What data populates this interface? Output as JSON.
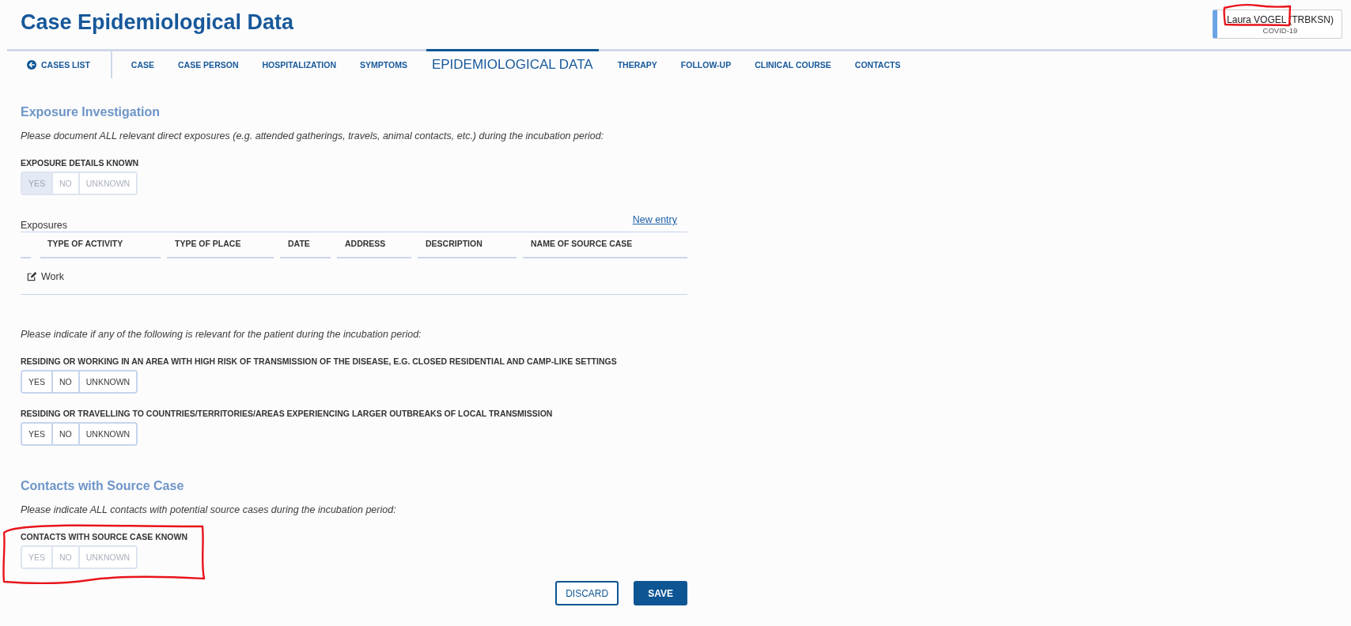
{
  "page": {
    "title": "Case Epidemiological Data"
  },
  "user": {
    "name": "Laura VOGEL (TRBKSN)",
    "disease": "COVID-19",
    "circled": true
  },
  "tabs": [
    {
      "label": "CASES LIST",
      "kind": "back",
      "selected": false
    },
    {
      "label": "CASE",
      "kind": "tab",
      "selected": false
    },
    {
      "label": "CASE PERSON",
      "kind": "tab",
      "selected": false
    },
    {
      "label": "HOSPITALIZATION",
      "kind": "tab",
      "selected": false
    },
    {
      "label": "SYMPTOMS",
      "kind": "tab",
      "selected": false
    },
    {
      "label": "EPIDEMIOLOGICAL DATA",
      "kind": "tab",
      "selected": true
    },
    {
      "label": "THERAPY",
      "kind": "tab",
      "selected": false
    },
    {
      "label": "FOLLOW-UP",
      "kind": "tab",
      "selected": false
    },
    {
      "label": "CLINICAL COURSE",
      "kind": "tab",
      "selected": false
    },
    {
      "label": "CONTACTS",
      "kind": "tab",
      "selected": false
    }
  ],
  "content": [
    {
      "kind": "heading",
      "text": "Exposure Investigation"
    },
    {
      "kind": "note",
      "text": "Please document ALL relevant direct exposures (e.g. attended gatherings, travels, animal contacts, etc.) during the incubation period:"
    },
    {
      "kind": "choice",
      "label": "EXPOSURE DETAILS KNOWN",
      "disabled": true,
      "options": [
        {
          "label": "YES",
          "selected": true
        },
        {
          "label": "NO",
          "selected": false
        },
        {
          "label": "UNKNOWN",
          "selected": false
        }
      ]
    },
    {
      "kind": "table",
      "title": "Exposures",
      "link": "New entry",
      "columns": [
        "TYPE OF ACTIVITY",
        "TYPE OF PLACE",
        "DATE",
        "ADDRESS",
        "DESCRIPTION",
        "NAME OF SOURCE CASE"
      ],
      "rows": [
        {
          "cells": [
            "Work"
          ]
        }
      ]
    },
    {
      "kind": "note",
      "text": "Please indicate if any of the following is relevant for the patient during the incubation period:"
    },
    {
      "kind": "choice",
      "label": "RESIDING OR WORKING IN AN AREA WITH HIGH RISK OF TRANSMISSION OF THE DISEASE, E.G. CLOSED RESIDENTIAL AND CAMP-LIKE SETTINGS",
      "disabled": false,
      "options": [
        {
          "label": "YES",
          "selected": false
        },
        {
          "label": "NO",
          "selected": false
        },
        {
          "label": "UNKNOWN",
          "selected": false
        }
      ]
    },
    {
      "kind": "choice",
      "label": "RESIDING OR TRAVELLING TO COUNTRIES/TERRITORIES/AREAS EXPERIENCING LARGER OUTBREAKS OF LOCAL TRANSMISSION",
      "disabled": false,
      "options": [
        {
          "label": "YES",
          "selected": false
        },
        {
          "label": "NO",
          "selected": false
        },
        {
          "label": "UNKNOWN",
          "selected": false
        }
      ]
    },
    {
      "kind": "heading",
      "text": "Contacts with Source Case"
    },
    {
      "kind": "note",
      "text": "Please indicate ALL contacts with potential source cases during the incubation period:"
    },
    {
      "kind": "choice",
      "label": "CONTACTS WITH SOURCE CASE KNOWN",
      "disabled": true,
      "circled": true,
      "options": [
        {
          "label": "YES",
          "selected": false
        },
        {
          "label": "NO",
          "selected": false
        },
        {
          "label": "UNKNOWN",
          "selected": false
        }
      ]
    }
  ],
  "buttons": [
    {
      "label": "DISCARD",
      "kind": "secondary"
    },
    {
      "label": "SAVE",
      "kind": "primary"
    }
  ]
}
